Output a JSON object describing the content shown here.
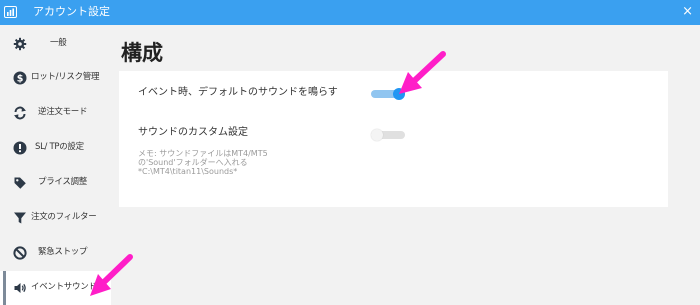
{
  "window": {
    "title": "アカウント設定",
    "close_label": "×"
  },
  "sidebar": {
    "items": [
      {
        "label": "一般",
        "icon": "gear-icon"
      },
      {
        "label": "ロット/リスク管理",
        "icon": "dollar-icon"
      },
      {
        "label": "逆注文モード",
        "icon": "sync-icon"
      },
      {
        "label": "SL/ TPの設定",
        "icon": "alert-icon"
      },
      {
        "label": "プライス調整",
        "icon": "tag-icon"
      },
      {
        "label": "注文のフィルター",
        "icon": "filter-icon"
      },
      {
        "label": "緊急ストップ",
        "icon": "ban-icon"
      },
      {
        "label": "イベントサウンド",
        "icon": "speaker-icon",
        "active": true
      }
    ]
  },
  "main": {
    "heading": "構成",
    "settings": [
      {
        "label": "イベント時、デフォルトのサウンドを鳴らす",
        "toggle": "on"
      },
      {
        "label": "サウンドのカスタム設定",
        "toggle": "off"
      }
    ],
    "memo": [
      "メモ: サウンドファイルはMT4/MT5",
      "の'Sound'フォルダーへ入れる",
      "*C:\\MT4\\titan11\\Sounds*"
    ]
  },
  "colors": {
    "titlebar": "#3aa0f0",
    "toggle_on": "#2196f3",
    "annotation_arrow": "#ff1ec8"
  }
}
